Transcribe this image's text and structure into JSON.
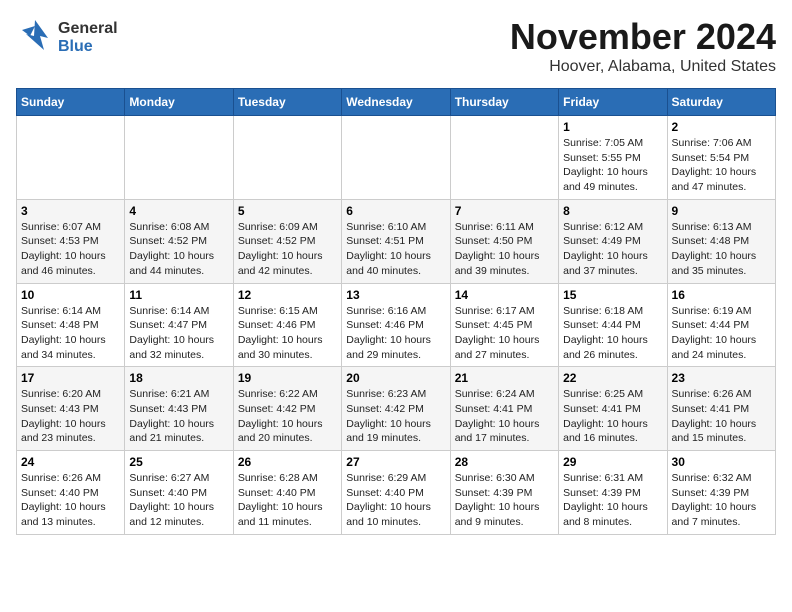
{
  "header": {
    "logo": {
      "general": "General",
      "blue": "Blue"
    },
    "title": "November 2024",
    "subtitle": "Hoover, Alabama, United States"
  },
  "weekdays": [
    "Sunday",
    "Monday",
    "Tuesday",
    "Wednesday",
    "Thursday",
    "Friday",
    "Saturday"
  ],
  "weeks": [
    [
      {
        "day": "",
        "info": ""
      },
      {
        "day": "",
        "info": ""
      },
      {
        "day": "",
        "info": ""
      },
      {
        "day": "",
        "info": ""
      },
      {
        "day": "",
        "info": ""
      },
      {
        "day": "1",
        "info": "Sunrise: 7:05 AM\nSunset: 5:55 PM\nDaylight: 10 hours\nand 49 minutes."
      },
      {
        "day": "2",
        "info": "Sunrise: 7:06 AM\nSunset: 5:54 PM\nDaylight: 10 hours\nand 47 minutes."
      }
    ],
    [
      {
        "day": "3",
        "info": "Sunrise: 6:07 AM\nSunset: 4:53 PM\nDaylight: 10 hours\nand 46 minutes."
      },
      {
        "day": "4",
        "info": "Sunrise: 6:08 AM\nSunset: 4:52 PM\nDaylight: 10 hours\nand 44 minutes."
      },
      {
        "day": "5",
        "info": "Sunrise: 6:09 AM\nSunset: 4:52 PM\nDaylight: 10 hours\nand 42 minutes."
      },
      {
        "day": "6",
        "info": "Sunrise: 6:10 AM\nSunset: 4:51 PM\nDaylight: 10 hours\nand 40 minutes."
      },
      {
        "day": "7",
        "info": "Sunrise: 6:11 AM\nSunset: 4:50 PM\nDaylight: 10 hours\nand 39 minutes."
      },
      {
        "day": "8",
        "info": "Sunrise: 6:12 AM\nSunset: 4:49 PM\nDaylight: 10 hours\nand 37 minutes."
      },
      {
        "day": "9",
        "info": "Sunrise: 6:13 AM\nSunset: 4:48 PM\nDaylight: 10 hours\nand 35 minutes."
      }
    ],
    [
      {
        "day": "10",
        "info": "Sunrise: 6:14 AM\nSunset: 4:48 PM\nDaylight: 10 hours\nand 34 minutes."
      },
      {
        "day": "11",
        "info": "Sunrise: 6:14 AM\nSunset: 4:47 PM\nDaylight: 10 hours\nand 32 minutes."
      },
      {
        "day": "12",
        "info": "Sunrise: 6:15 AM\nSunset: 4:46 PM\nDaylight: 10 hours\nand 30 minutes."
      },
      {
        "day": "13",
        "info": "Sunrise: 6:16 AM\nSunset: 4:46 PM\nDaylight: 10 hours\nand 29 minutes."
      },
      {
        "day": "14",
        "info": "Sunrise: 6:17 AM\nSunset: 4:45 PM\nDaylight: 10 hours\nand 27 minutes."
      },
      {
        "day": "15",
        "info": "Sunrise: 6:18 AM\nSunset: 4:44 PM\nDaylight: 10 hours\nand 26 minutes."
      },
      {
        "day": "16",
        "info": "Sunrise: 6:19 AM\nSunset: 4:44 PM\nDaylight: 10 hours\nand 24 minutes."
      }
    ],
    [
      {
        "day": "17",
        "info": "Sunrise: 6:20 AM\nSunset: 4:43 PM\nDaylight: 10 hours\nand 23 minutes."
      },
      {
        "day": "18",
        "info": "Sunrise: 6:21 AM\nSunset: 4:43 PM\nDaylight: 10 hours\nand 21 minutes."
      },
      {
        "day": "19",
        "info": "Sunrise: 6:22 AM\nSunset: 4:42 PM\nDaylight: 10 hours\nand 20 minutes."
      },
      {
        "day": "20",
        "info": "Sunrise: 6:23 AM\nSunset: 4:42 PM\nDaylight: 10 hours\nand 19 minutes."
      },
      {
        "day": "21",
        "info": "Sunrise: 6:24 AM\nSunset: 4:41 PM\nDaylight: 10 hours\nand 17 minutes."
      },
      {
        "day": "22",
        "info": "Sunrise: 6:25 AM\nSunset: 4:41 PM\nDaylight: 10 hours\nand 16 minutes."
      },
      {
        "day": "23",
        "info": "Sunrise: 6:26 AM\nSunset: 4:41 PM\nDaylight: 10 hours\nand 15 minutes."
      }
    ],
    [
      {
        "day": "24",
        "info": "Sunrise: 6:26 AM\nSunset: 4:40 PM\nDaylight: 10 hours\nand 13 minutes."
      },
      {
        "day": "25",
        "info": "Sunrise: 6:27 AM\nSunset: 4:40 PM\nDaylight: 10 hours\nand 12 minutes."
      },
      {
        "day": "26",
        "info": "Sunrise: 6:28 AM\nSunset: 4:40 PM\nDaylight: 10 hours\nand 11 minutes."
      },
      {
        "day": "27",
        "info": "Sunrise: 6:29 AM\nSunset: 4:40 PM\nDaylight: 10 hours\nand 10 minutes."
      },
      {
        "day": "28",
        "info": "Sunrise: 6:30 AM\nSunset: 4:39 PM\nDaylight: 10 hours\nand 9 minutes."
      },
      {
        "day": "29",
        "info": "Sunrise: 6:31 AM\nSunset: 4:39 PM\nDaylight: 10 hours\nand 8 minutes."
      },
      {
        "day": "30",
        "info": "Sunrise: 6:32 AM\nSunset: 4:39 PM\nDaylight: 10 hours\nand 7 minutes."
      }
    ]
  ]
}
